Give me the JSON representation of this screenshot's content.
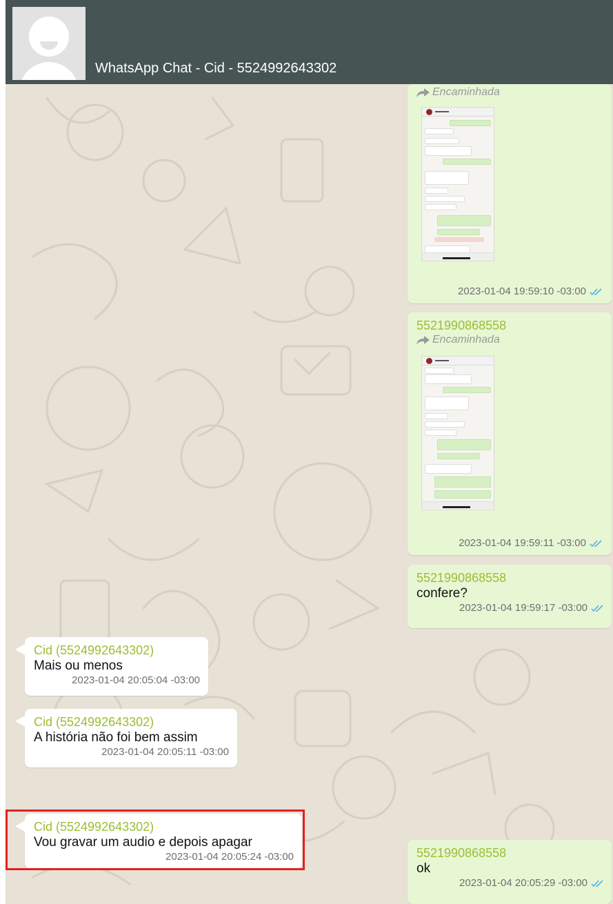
{
  "header": {
    "title": "WhatsApp Chat - Cid - 5524992643302",
    "avatar_icon": "default-avatar-icon",
    "background_color": "#465453"
  },
  "messages": [
    {
      "direction": "outgoing",
      "forwarded_label": "Encaminhada",
      "attachment": "screenshot-image",
      "timestamp": "2023-01-04 19:59:10 -03:00",
      "status_icon": "double-check-icon"
    },
    {
      "direction": "outgoing",
      "sender": "5521990868558",
      "forwarded_label": "Encaminhada",
      "attachment": "screenshot-image",
      "timestamp": "2023-01-04 19:59:11 -03:00",
      "status_icon": "double-check-icon"
    },
    {
      "direction": "outgoing",
      "sender": "5521990868558",
      "text": "confere?",
      "timestamp": "2023-01-04 19:59:17 -03:00",
      "status_icon": "double-check-icon"
    },
    {
      "direction": "incoming",
      "sender": "Cid (5524992643302)",
      "text": "Mais ou menos",
      "timestamp": "2023-01-04 20:05:04 -03:00"
    },
    {
      "direction": "incoming",
      "sender": "Cid (5524992643302)",
      "text": "A história não foi bem assim",
      "timestamp": "2023-01-04 20:05:11 -03:00"
    },
    {
      "direction": "incoming",
      "sender": "Cid (5524992643302)",
      "text": "Vou gravar um audio e depois apagar",
      "timestamp": "2023-01-04 20:05:24 -03:00",
      "highlighted": true
    },
    {
      "direction": "outgoing",
      "sender": "5521990868558",
      "text": "ok",
      "timestamp": "2023-01-04 20:05:29 -03:00",
      "status_icon": "double-check-icon"
    }
  ],
  "colors": {
    "outgoing_bubble": "#e7f7d4",
    "incoming_bubble": "#ffffff",
    "sender_name": "#9bbe31",
    "chat_background": "#e7e1d6",
    "read_ticks": "#4fb3e8",
    "highlight_border": "#e02020"
  }
}
